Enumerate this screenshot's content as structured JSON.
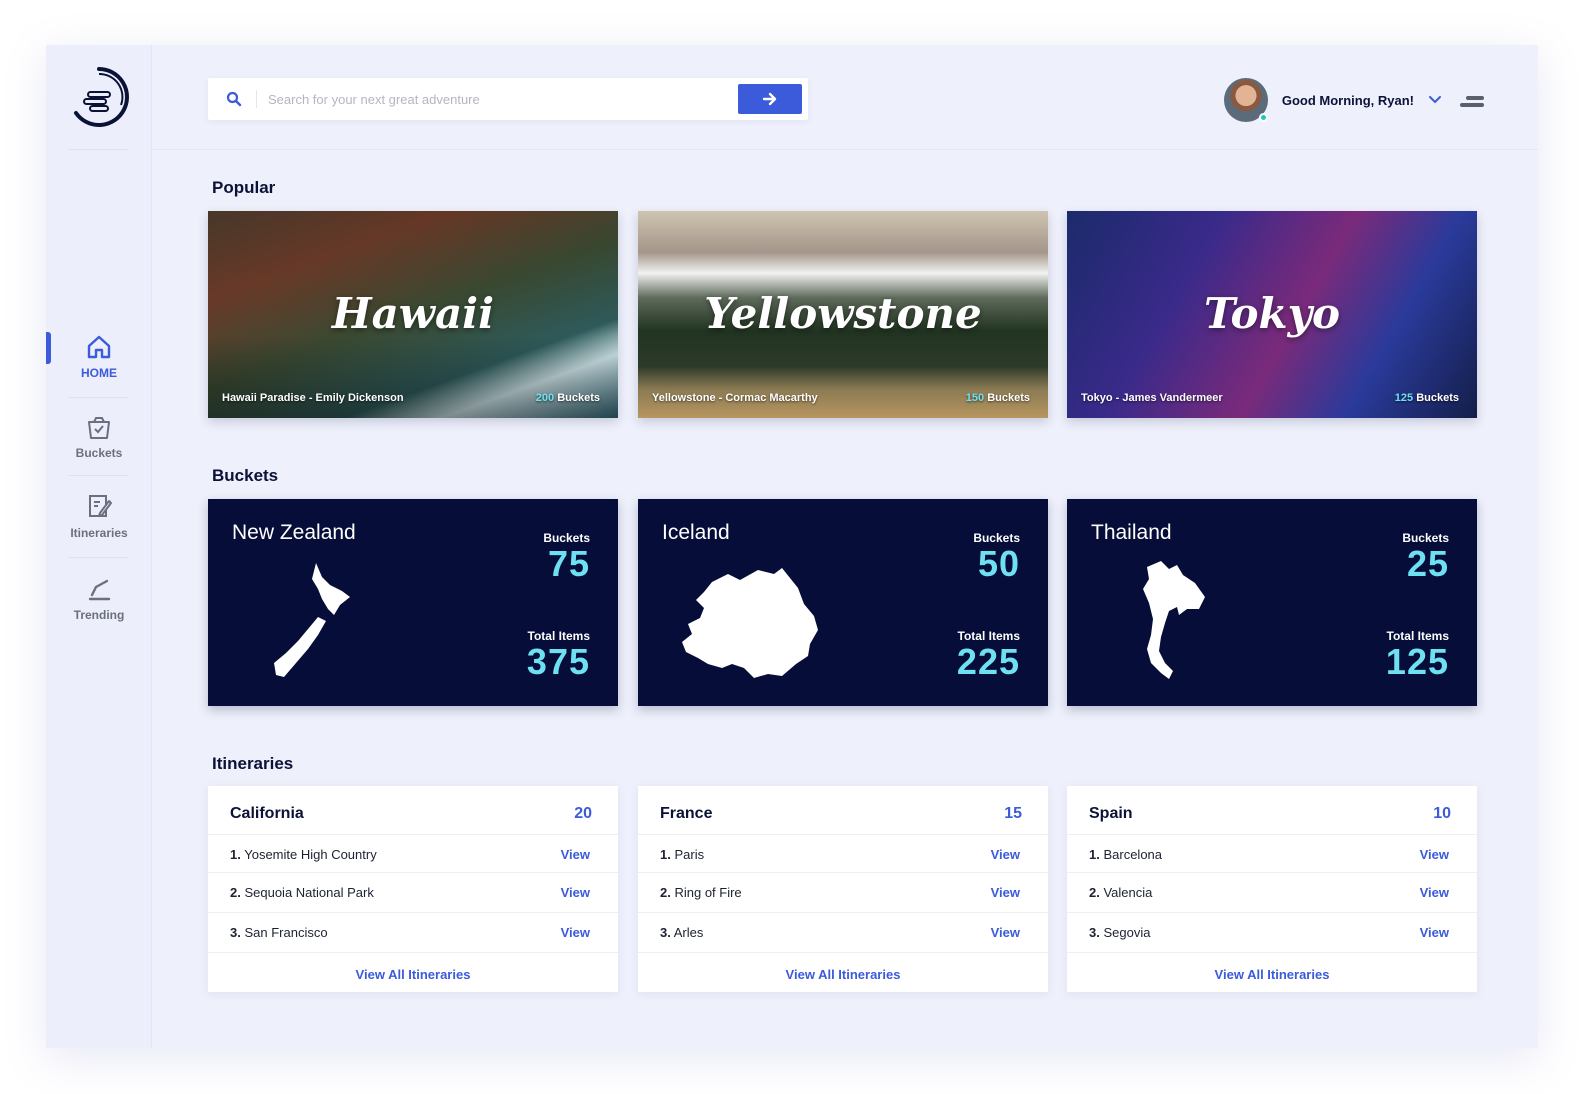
{
  "sidebar": {
    "items": [
      {
        "label": "HOME",
        "icon": "home-icon",
        "active": true
      },
      {
        "label": "Buckets",
        "icon": "basket-icon",
        "active": false
      },
      {
        "label": "Itineraries",
        "icon": "notepad-icon",
        "active": false
      },
      {
        "label": "Trending",
        "icon": "trending-icon",
        "active": false
      }
    ]
  },
  "header": {
    "search_placeholder": "Search for your next great adventure",
    "greeting": "Good Morning, Ryan!"
  },
  "sections": {
    "popular": "Popular",
    "buckets": "Buckets",
    "itineraries": "Itineraries"
  },
  "popular": [
    {
      "title": "Hawaii",
      "caption": "Hawaii Paradise - Emily Dickenson",
      "count": "200",
      "count_label": "Buckets"
    },
    {
      "title": "Yellowstone",
      "caption": "Yellowstone - Cormac Macarthy",
      "count": "150",
      "count_label": "Buckets"
    },
    {
      "title": "Tokyo",
      "caption": "Tokyo - James Vandermeer",
      "count": "125",
      "count_label": "Buckets"
    }
  ],
  "buckets": [
    {
      "name": "New Zealand",
      "buckets_label": "Buckets",
      "buckets": "75",
      "items_label": "Total Items",
      "items": "375"
    },
    {
      "name": "Iceland",
      "buckets_label": "Buckets",
      "buckets": "50",
      "items_label": "Total Items",
      "items": "225"
    },
    {
      "name": "Thailand",
      "buckets_label": "Buckets",
      "buckets": "25",
      "items_label": "Total Items",
      "items": "125"
    }
  ],
  "itineraries": [
    {
      "name": "California",
      "count": "20",
      "rows": [
        {
          "num": "1.",
          "text": "Yosemite High Country",
          "action": "View"
        },
        {
          "num": "2.",
          "text": "Sequoia National Park",
          "action": "View"
        },
        {
          "num": "3.",
          "text": "San Francisco",
          "action": "View"
        }
      ],
      "view_all": "View All Itineraries"
    },
    {
      "name": "France",
      "count": "15",
      "rows": [
        {
          "num": "1.",
          "text": "Paris",
          "action": "View"
        },
        {
          "num": "2.",
          "text": "Ring of Fire",
          "action": "View"
        },
        {
          "num": "3.",
          "text": "Arles",
          "action": "View"
        }
      ],
      "view_all": "View All Itineraries"
    },
    {
      "name": "Spain",
      "count": "10",
      "rows": [
        {
          "num": "1.",
          "text": "Barcelona",
          "action": "View"
        },
        {
          "num": "2.",
          "text": "Valencia",
          "action": "View"
        },
        {
          "num": "3.",
          "text": "Segovia",
          "action": "View"
        }
      ],
      "view_all": "View All Itineraries"
    }
  ],
  "colors": {
    "accent": "#3b5bdb",
    "highlight": "#6ee0f2",
    "navy": "#050d38"
  }
}
